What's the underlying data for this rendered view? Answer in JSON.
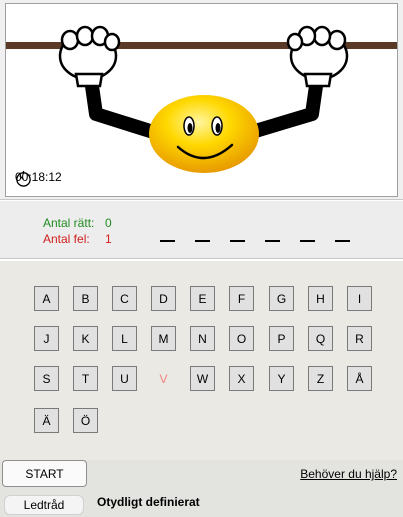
{
  "timer": {
    "text": "00:18:12"
  },
  "score": {
    "right_label": "Antal rätt:",
    "right_value": "0",
    "wrong_label": "Antal fel:",
    "wrong_value": "1"
  },
  "word": {
    "slot_count": 6
  },
  "keyboard": {
    "rows": [
      [
        {
          "letter": "A",
          "used": false
        },
        {
          "letter": "B",
          "used": false
        },
        {
          "letter": "C",
          "used": false
        },
        {
          "letter": "D",
          "used": false
        },
        {
          "letter": "E",
          "used": false
        },
        {
          "letter": "F",
          "used": false
        },
        {
          "letter": "G",
          "used": false
        },
        {
          "letter": "H",
          "used": false
        },
        {
          "letter": "I",
          "used": false
        }
      ],
      [
        {
          "letter": "J",
          "used": false
        },
        {
          "letter": "K",
          "used": false
        },
        {
          "letter": "L",
          "used": false
        },
        {
          "letter": "M",
          "used": false
        },
        {
          "letter": "N",
          "used": false
        },
        {
          "letter": "O",
          "used": false
        },
        {
          "letter": "P",
          "used": false
        },
        {
          "letter": "Q",
          "used": false
        },
        {
          "letter": "R",
          "used": false
        }
      ],
      [
        {
          "letter": "S",
          "used": false
        },
        {
          "letter": "T",
          "used": false
        },
        {
          "letter": "U",
          "used": false
        },
        {
          "letter": "V",
          "used": true
        },
        {
          "letter": "W",
          "used": false
        },
        {
          "letter": "X",
          "used": false
        },
        {
          "letter": "Y",
          "used": false
        },
        {
          "letter": "Z",
          "used": false
        },
        {
          "letter": "Å",
          "used": false
        }
      ],
      [
        {
          "letter": "Ä",
          "used": false
        },
        {
          "letter": "Ö",
          "used": false
        }
      ]
    ]
  },
  "buttons": {
    "start_label": "START",
    "help_label": "Behöver du hjälp?",
    "hint_label": "Ledtråd"
  },
  "hint": {
    "text": "Otydligt definierat"
  },
  "colors": {
    "right": "#228b22",
    "wrong": "#d21e1e",
    "used_letter": "#f08080",
    "smiley": "#ffd700",
    "bar": "#5a3a26"
  },
  "icons": {
    "timer": "stopwatch-icon"
  }
}
